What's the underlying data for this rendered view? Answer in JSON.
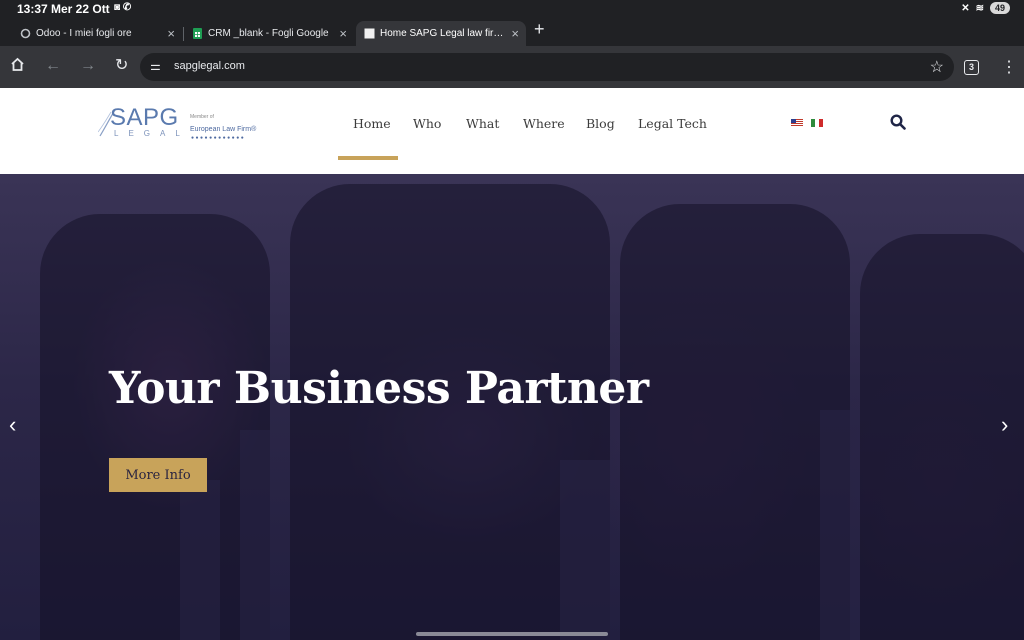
{
  "status_bar": {
    "time": "13:37",
    "date": "Mer 22 Ott",
    "battery": "49"
  },
  "tabs": [
    {
      "title": "Odoo - I miei fogli ore",
      "favicon": "odoo-icon"
    },
    {
      "title": "CRM _blank - Fogli Google",
      "favicon": "sheets-icon"
    },
    {
      "title": "Home SAPG Legal law firm international",
      "favicon": "page-icon",
      "active": true
    }
  ],
  "toolbar": {
    "url": "sapglegal.com",
    "tab_count": "3"
  },
  "site": {
    "logo": {
      "brand": "SAPG",
      "brand_sub": "LEGAL",
      "member_of": "Member of",
      "network": "European Law Firm®"
    },
    "nav": [
      "Home",
      "Who",
      "What",
      "Where",
      "Blog",
      "Legal Tech"
    ],
    "languages": [
      "English",
      "Italiano"
    ],
    "accent_color": "#c8a35a"
  },
  "hero": {
    "title": "Your Business Partner",
    "button": "More Info"
  }
}
